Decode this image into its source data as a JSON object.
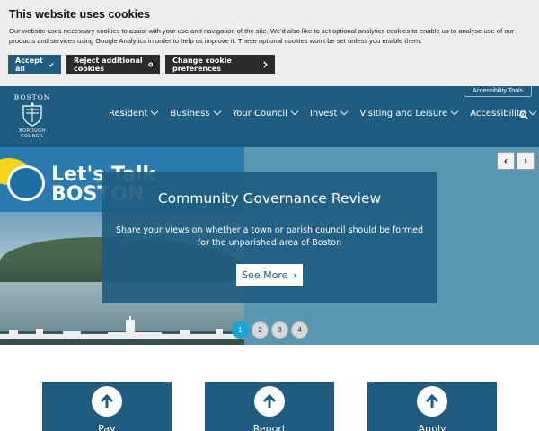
{
  "cookie": {
    "title": "This website uses cookies",
    "text": "Our website uses necessary cookies to assist with your use and navigation of the site. We'd also like to set optional analytics cookies to enable us to analyse use of our products and services using Google Analytics in order to help us improve it. These optional cookies won't be set unless you enable them.",
    "accept_label": "Accept all",
    "reject_label": "Reject additional cookies",
    "change_label": "Change cookie preferences"
  },
  "header": {
    "logo_top": "BOSTON",
    "logo_bottom": "BOROUGH COUNCIL",
    "accessibility_tools": "Accessibility Tools",
    "nav": [
      "Resident",
      "Business",
      "Your Council",
      "Invest",
      "Visiting and Leisure",
      "Accessibility"
    ],
    "icons": {
      "search": "search-icon"
    }
  },
  "hero": {
    "image_text_line1": "Let's Talk",
    "image_text_line2": "BOSTON",
    "title": "Community Governance Review",
    "description": "Share your views on whether a town or parish council should be formed for the unparished area of Boston",
    "button_label": "See More",
    "prev": "‹",
    "next": "›",
    "slides": [
      "1",
      "2",
      "3",
      "4"
    ],
    "active_slide": 1
  },
  "tiles": [
    {
      "label": "Pay",
      "icon": "arrow-up-circle-icon"
    },
    {
      "label": "Report",
      "icon": "arrow-up-circle-icon"
    },
    {
      "label": "Apply",
      "icon": "arrow-up-circle-icon"
    }
  ],
  "colors": {
    "brand": "#1f5c80",
    "hero_bg": "#5a97b1",
    "active_dot": "#1aa3d9",
    "cookie_bg": "#eeeeee"
  }
}
